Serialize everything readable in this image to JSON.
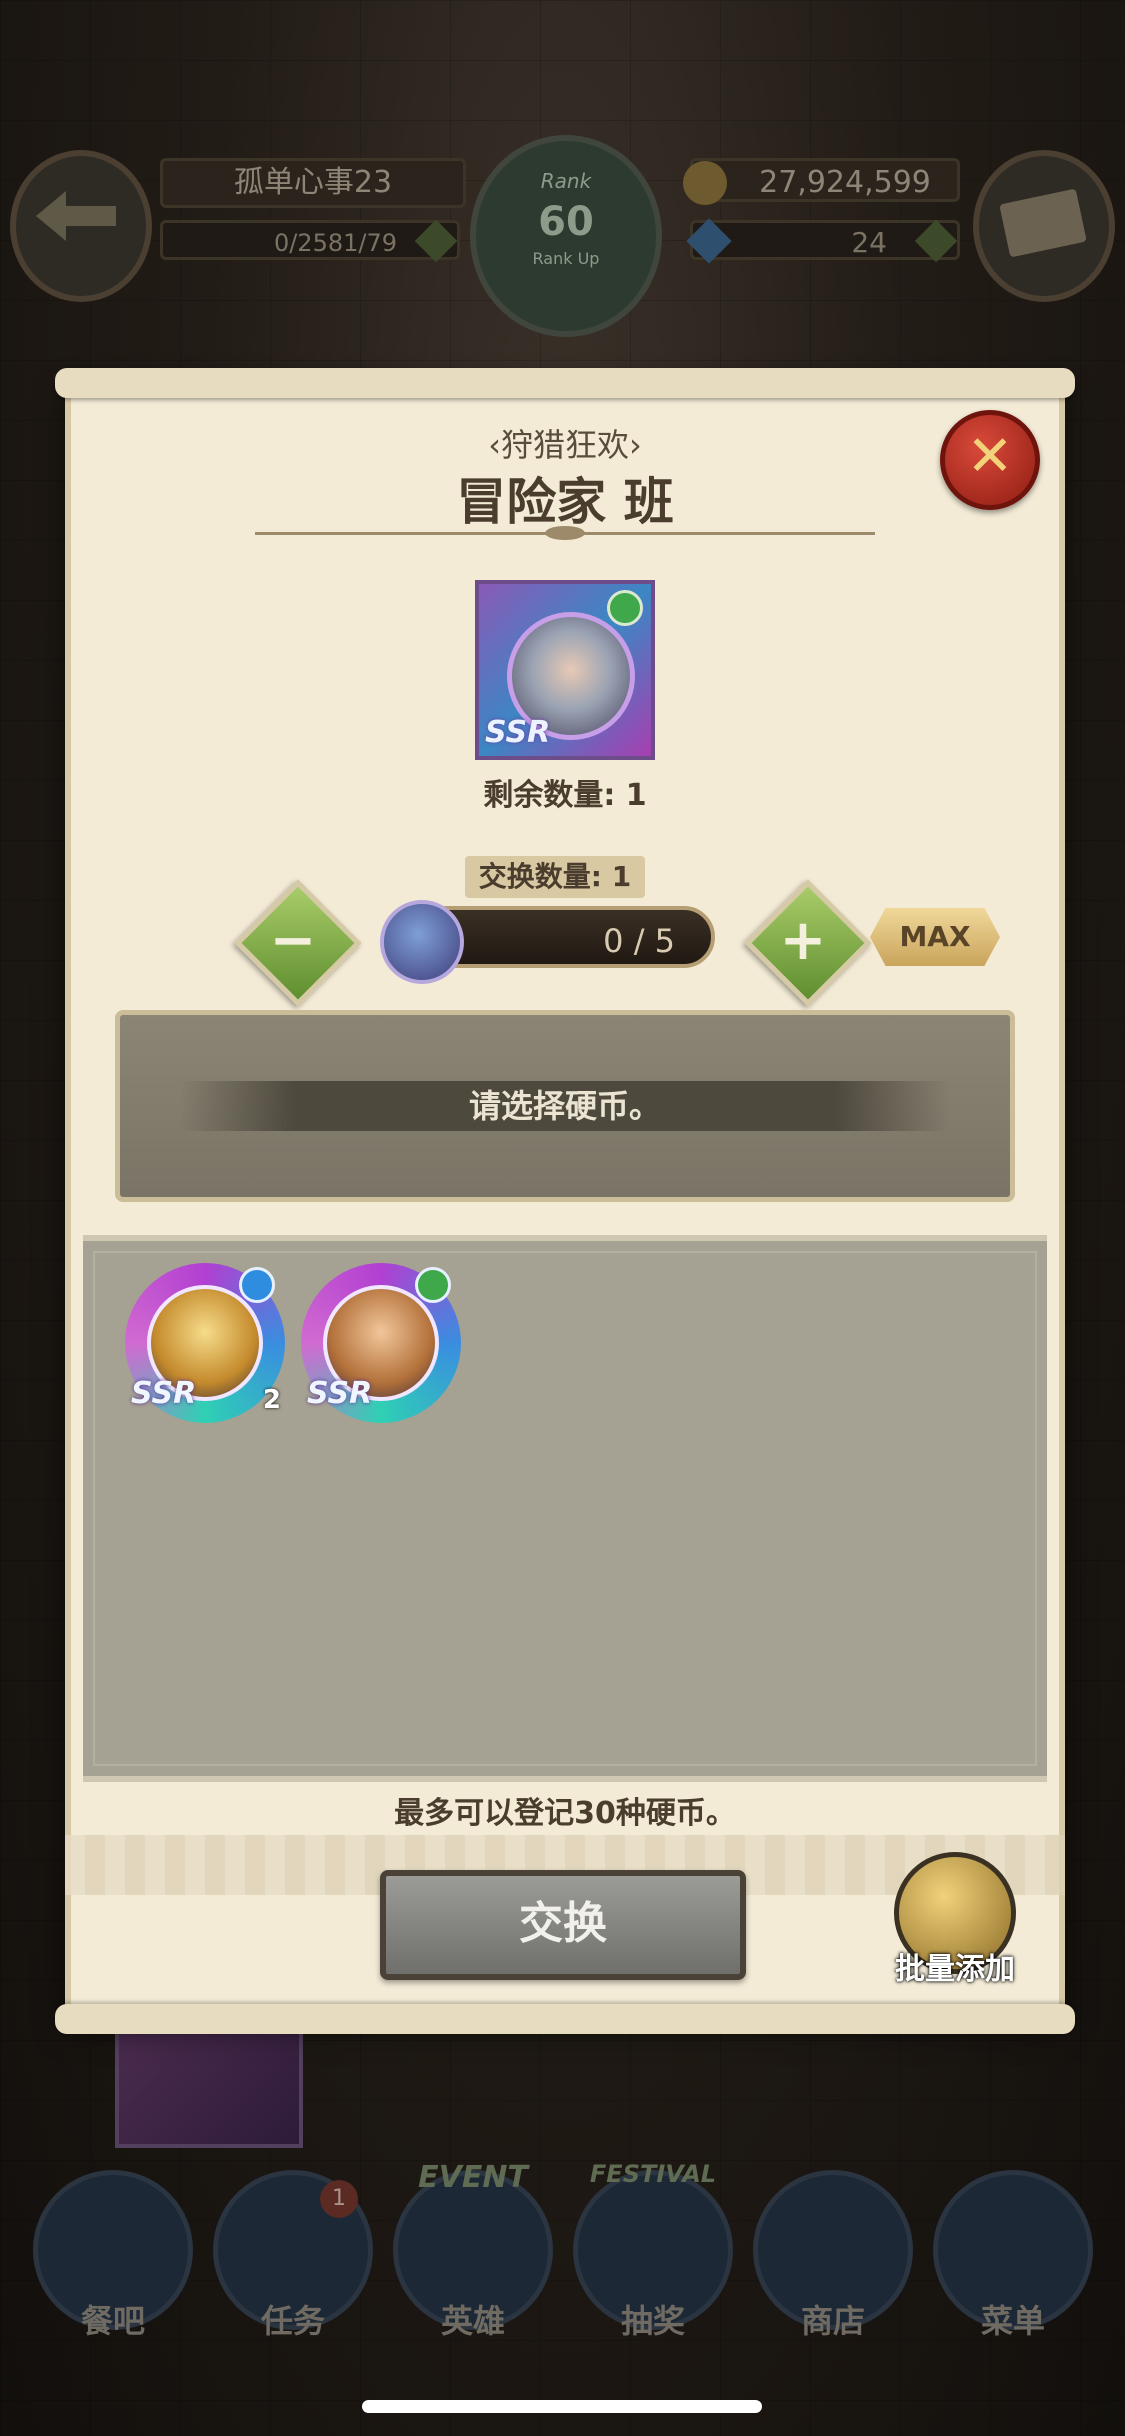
{
  "hud": {
    "player_name": "孤单心事23",
    "exp": "0/2581/79",
    "rank_label": "Rank",
    "rank_value": "60",
    "rank_sub": "Rank Up",
    "gold": "27,924,599",
    "gems": "24"
  },
  "modal": {
    "event_subtitle": "‹狩猎狂欢›",
    "title": "冒险家 班",
    "remaining": "剩余数量: 1",
    "exchange_qty_label": "交换数量: 1",
    "progress": "0 / 5",
    "max_label": "MAX",
    "select_prompt": "请选择硬币。",
    "limit_note": "最多可以登记30种硬币。",
    "exchange_button": "交换",
    "bulk_add_label": "批量添加",
    "main_coin_rarity": "SSR",
    "coins": [
      {
        "rarity": "SSR",
        "count": "2",
        "attr_color": "#2f8de0",
        "face_color": "#e9c25a"
      },
      {
        "rarity": "SSR",
        "count": "",
        "attr_color": "#3ea84a",
        "face_color": "#d59c5a"
      }
    ]
  },
  "nav": {
    "items": [
      {
        "label": "餐吧"
      },
      {
        "label": "任务",
        "badge": "1"
      },
      {
        "label": "英雄",
        "ribbon": "EVENT"
      },
      {
        "label": "抽奖",
        "ribbon": "FESTIVAL"
      },
      {
        "label": "商店"
      },
      {
        "label": "菜单"
      }
    ]
  },
  "icons": {
    "back": "back-arrow-icon",
    "mail": "mail-icon",
    "close": "close-icon",
    "minus": "minus-icon",
    "plus": "plus-icon",
    "bulk": "medal-icon"
  }
}
